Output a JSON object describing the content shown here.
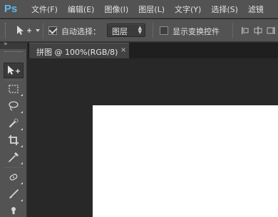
{
  "app": {
    "logo": "Ps"
  },
  "menu": {
    "items": [
      {
        "label": "文件(F)"
      },
      {
        "label": "编辑(E)"
      },
      {
        "label": "图像(I)"
      },
      {
        "label": "图层(L)"
      },
      {
        "label": "文字(Y)"
      },
      {
        "label": "选择(S)"
      },
      {
        "label": "滤镜"
      }
    ]
  },
  "options": {
    "auto_select_label": "自动选择：",
    "auto_select_checked": true,
    "auto_select_target": "图层",
    "show_transform_label": "显示变换控件",
    "show_transform_checked": false
  },
  "toolbox": {
    "tools": [
      {
        "icon": "move-tool-icon",
        "active": true
      },
      {
        "icon": "marquee-tool-icon"
      },
      {
        "icon": "lasso-tool-icon"
      },
      {
        "icon": "quick-selection-tool-icon"
      },
      {
        "icon": "crop-tool-icon"
      },
      {
        "icon": "eyedropper-tool-icon"
      },
      {
        "icon": "spot-healing-tool-icon"
      },
      {
        "icon": "brush-tool-icon"
      },
      {
        "icon": "clone-stamp-tool-icon"
      }
    ]
  },
  "document": {
    "tab_label": "拼图 @ 100%(RGB/8)",
    "close_glyph": "×"
  },
  "colors": {
    "panel": "#535353",
    "workspace": "#282828",
    "logo": "#5fb8f0",
    "canvas": "#ffffff"
  }
}
